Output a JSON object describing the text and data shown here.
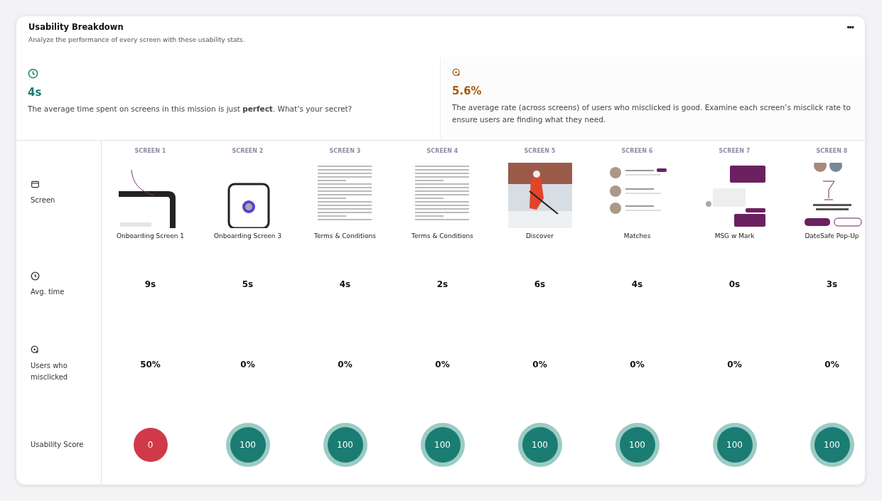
{
  "header": {
    "title": "Usability Breakdown",
    "subtitle": "Analyze the performance of every screen with these usability stats.",
    "menu": "•••"
  },
  "summary": [
    {
      "kind": "time",
      "value": "4s",
      "text": "The average time spent on screens in this mission is just **perfect**. What’s your secret?"
    },
    {
      "kind": "misclick",
      "value": "5.6%",
      "text": "The average rate (across screens) of users who misclicked is good. Examine each screen’s misclick rate to ensure users are finding what they need."
    }
  ],
  "row_labels": [
    {
      "kind": "screen",
      "label": "Screen"
    },
    {
      "kind": "time",
      "label": "Avg. time"
    },
    {
      "kind": "misclick",
      "label": "Users who misclicked"
    },
    {
      "kind": "score",
      "label": "Usability Score"
    }
  ],
  "screens": [
    {
      "heading": "SCREEN 1",
      "name": "Onboarding Screen 1",
      "thumbnail": {
        "kind": "phone"
      },
      "time": "9s",
      "misclicks": "50%",
      "score": {
        "value": "0",
        "kind": "bad"
      }
    },
    {
      "heading": "SCREEN 2",
      "name": "Onboarding Screen 3",
      "thumbnail": {
        "kind": "card"
      },
      "time": "5s",
      "misclicks": "0%",
      "score": {
        "value": "100",
        "kind": "good"
      }
    },
    {
      "heading": "SCREEN 3",
      "name": "Terms & Conditions",
      "thumbnail": {
        "kind": "document"
      },
      "time": "4s",
      "misclicks": "0%",
      "score": {
        "value": "100",
        "kind": "good"
      }
    },
    {
      "heading": "SCREEN 4",
      "name": "Terms & Conditions",
      "thumbnail": {
        "kind": "document"
      },
      "time": "2s",
      "misclicks": "0%",
      "score": {
        "value": "100",
        "kind": "good"
      }
    },
    {
      "heading": "SCREEN 5",
      "name": "Discover",
      "thumbnail": {
        "kind": "photo"
      },
      "time": "6s",
      "misclicks": "0%",
      "score": {
        "value": "100",
        "kind": "good"
      }
    },
    {
      "heading": "SCREEN 6",
      "name": "Matches",
      "thumbnail": {
        "kind": "list"
      },
      "time": "4s",
      "misclicks": "0%",
      "score": {
        "value": "100",
        "kind": "good"
      }
    },
    {
      "heading": "SCREEN 7",
      "name": "MSG w Mark",
      "thumbnail": {
        "kind": "chat"
      },
      "time": "0s",
      "misclicks": "0%",
      "score": {
        "value": "100",
        "kind": "good"
      }
    },
    {
      "heading": "SCREEN 8",
      "name": "DateSafe Pop-Up",
      "thumbnail": {
        "kind": "popup"
      },
      "time": "3s",
      "misclicks": "0%",
      "score": {
        "value": "100",
        "kind": "good"
      }
    }
  ]
}
